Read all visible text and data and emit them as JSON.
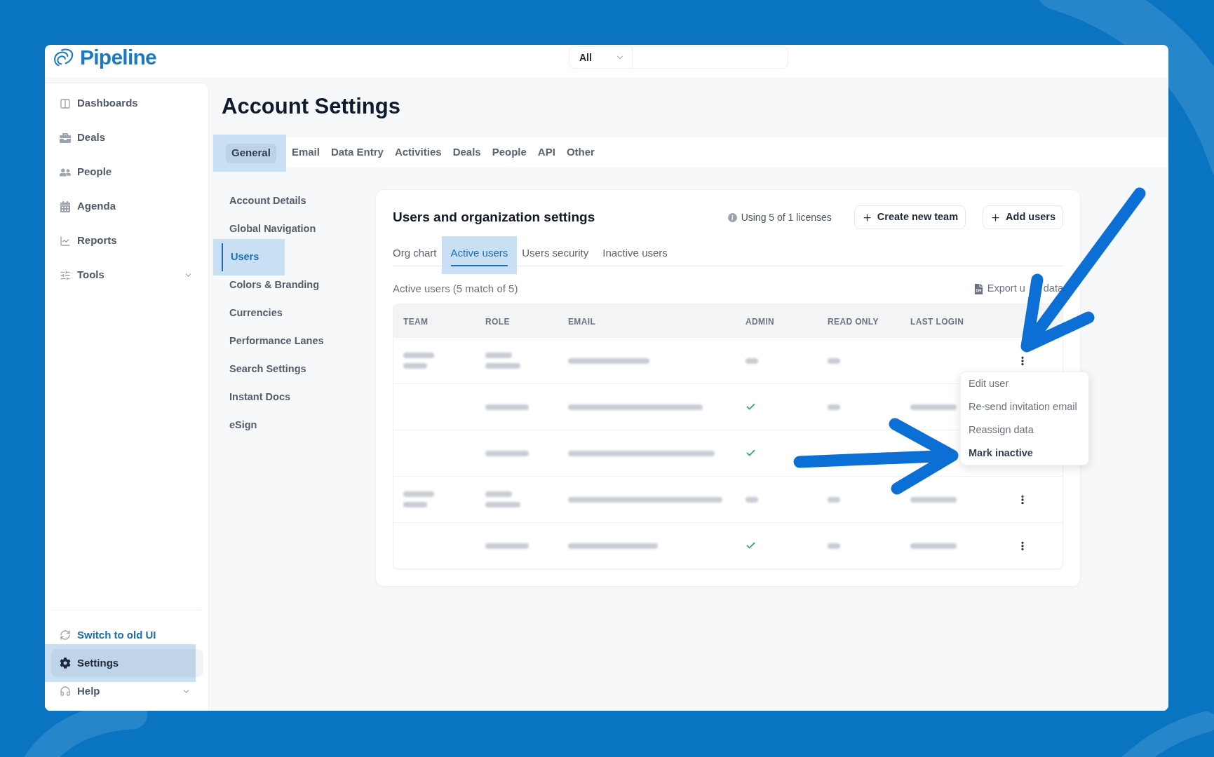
{
  "header": {
    "logo": "Pipeline",
    "search_scope": "All"
  },
  "sidebar": {
    "items": [
      {
        "label": "Dashboards",
        "kind": "link",
        "selected": false
      },
      {
        "label": "Deals",
        "kind": "link",
        "selected": false
      },
      {
        "label": "People",
        "kind": "link",
        "selected": false
      },
      {
        "label": "Agenda",
        "kind": "link",
        "selected": false
      },
      {
        "label": "Reports",
        "kind": "link",
        "selected": false
      },
      {
        "label": "Tools",
        "kind": "group",
        "selected": false
      }
    ],
    "footer_items": [
      {
        "label": "Switch to old UI",
        "kind": "action",
        "selected": false,
        "highlighted": false
      },
      {
        "label": "Settings",
        "kind": "link",
        "selected": true,
        "highlighted": true
      },
      {
        "label": "Help",
        "kind": "group",
        "selected": false,
        "highlighted": false
      }
    ]
  },
  "page": {
    "title": "Account Settings",
    "tabs": [
      {
        "label": "General",
        "selected": true,
        "highlighted": true
      },
      {
        "label": "Email",
        "selected": false,
        "highlighted": false
      },
      {
        "label": "Data Entry",
        "selected": false,
        "highlighted": false
      },
      {
        "label": "Activities",
        "selected": false,
        "highlighted": false
      },
      {
        "label": "Deals",
        "selected": false,
        "highlighted": false
      },
      {
        "label": "People",
        "selected": false,
        "highlighted": false
      },
      {
        "label": "API",
        "selected": false,
        "highlighted": false
      },
      {
        "label": "Other",
        "selected": false,
        "highlighted": false
      }
    ],
    "subnav": [
      {
        "label": "Account Details",
        "selected": false,
        "highlighted": false
      },
      {
        "label": "Global Navigation",
        "selected": false,
        "highlighted": false
      },
      {
        "label": "Users",
        "selected": true,
        "highlighted": true
      },
      {
        "label": "Colors & Branding",
        "selected": false,
        "highlighted": false
      },
      {
        "label": "Currencies",
        "selected": false,
        "highlighted": false
      },
      {
        "label": "Performance Lanes",
        "selected": false,
        "highlighted": false
      },
      {
        "label": "Search Settings",
        "selected": false,
        "highlighted": false
      },
      {
        "label": "Instant Docs",
        "selected": false,
        "highlighted": false
      },
      {
        "label": "eSign",
        "selected": false,
        "highlighted": false
      }
    ],
    "panel": {
      "title": "Users and organization settings",
      "license_note": "Using 5 of 1 licenses",
      "buttons": [
        "Create new team",
        "Add users"
      ],
      "tabs": [
        {
          "label": "Org chart",
          "selected": false,
          "highlighted": false
        },
        {
          "label": "Active users",
          "selected": true,
          "highlighted": true
        },
        {
          "label": "Users security",
          "selected": false,
          "highlighted": false
        },
        {
          "label": "Inactive users",
          "selected": false,
          "highlighted": false
        }
      ],
      "result_count": "Active users (5 match of 5)",
      "export_link": [
        "Export u",
        "data"
      ],
      "table": {
        "columns": [
          "TEAM",
          "ROLE",
          "EMAIL",
          "ADMIN",
          "READ ONLY",
          "LAST LOGIN"
        ],
        "rows": [
          {
            "team_blurred": true,
            "admin": false,
            "read_only_blurred": true,
            "last_login_blurred": false,
            "menu_open": true
          },
          {
            "team_blurred": false,
            "admin": true,
            "read_only_blurred": true,
            "last_login_blurred": true,
            "menu_open": false
          },
          {
            "team_blurred": false,
            "admin": true,
            "read_only_blurred": false,
            "last_login_blurred": false,
            "menu_open": false
          },
          {
            "team_blurred": true,
            "admin": false,
            "read_only_blurred": true,
            "last_login_blurred": true,
            "menu_open": false
          },
          {
            "team_blurred": false,
            "admin": true,
            "read_only_blurred": true,
            "last_login_blurred": true,
            "menu_open": false
          }
        ],
        "row_menu": {
          "items": [
            {
              "label": "Edit user",
              "hovered": false
            },
            {
              "label": "Re-send invitation email",
              "hovered": false
            },
            {
              "label": "Reassign data",
              "hovered": false
            },
            {
              "label": "Mark inactive",
              "hovered": true
            }
          ]
        }
      }
    }
  }
}
